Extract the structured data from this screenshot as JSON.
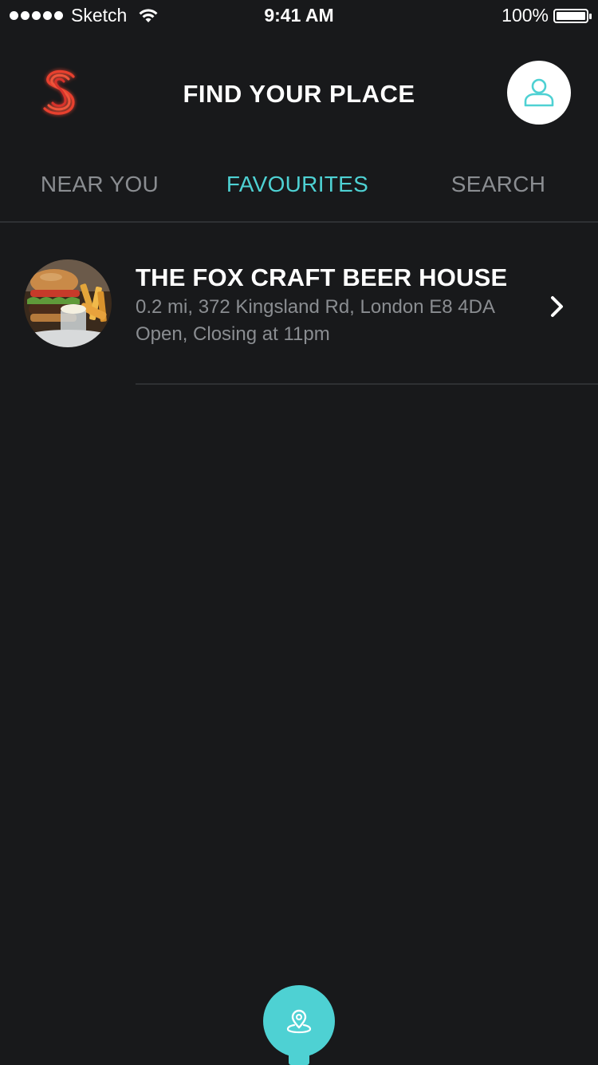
{
  "status_bar": {
    "carrier": "Sketch",
    "time": "9:41 AM",
    "battery_percent": "100%",
    "battery_level": 1.0,
    "signal_dots": 5
  },
  "header": {
    "title": "FIND YOUR PLACE",
    "logo_icon": "s-logo-icon",
    "profile_icon": "user-icon"
  },
  "tabs": [
    {
      "label": "NEAR YOU",
      "active": false
    },
    {
      "label": "FAVOURITES",
      "active": true
    },
    {
      "label": "SEARCH",
      "active": false
    }
  ],
  "favourites": [
    {
      "name": "THE FOX CRAFT BEER HOUSE",
      "address": "0.2 mi, 372 Kingsland Rd, London E8 4DA",
      "status": "Open, Closing at 11pm",
      "thumbnail_icon": "burger-photo",
      "action_icon": "chevron-right-icon"
    }
  ],
  "bottom_action": {
    "icon": "map-pin-icon"
  },
  "colors": {
    "background": "#18191b",
    "accent": "#4ed1d3",
    "tab_inactive": "#8a8d91",
    "text_primary": "#ffffff",
    "text_secondary": "#8a8d91",
    "logo_red": "#e8402f"
  }
}
